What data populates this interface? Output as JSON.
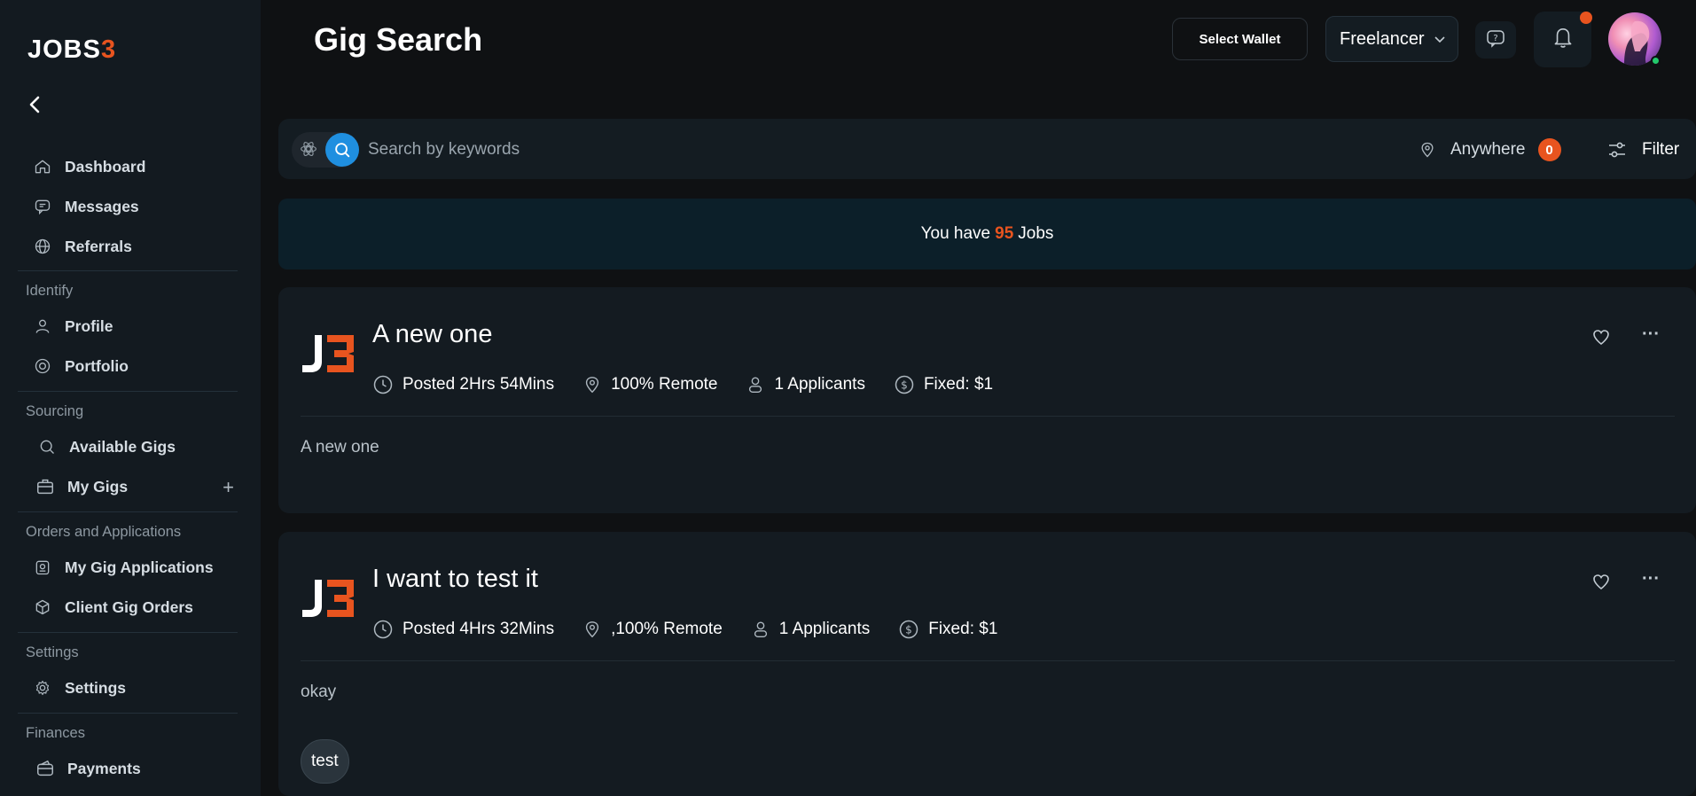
{
  "app": {
    "logo_text": "JOBS",
    "logo_accent": "3",
    "brand_color": "#e8541f"
  },
  "sidebar": {
    "items": [
      {
        "label": "Dashboard",
        "icon": "home-icon"
      },
      {
        "label": "Messages",
        "icon": "message-icon"
      },
      {
        "label": "Referrals",
        "icon": "globe-icon"
      }
    ],
    "sections": [
      {
        "label": "Identify",
        "items": [
          {
            "label": "Profile",
            "icon": "user-icon"
          },
          {
            "label": "Portfolio",
            "icon": "target-icon"
          }
        ]
      },
      {
        "label": "Sourcing",
        "items": [
          {
            "label": "Available Gigs",
            "icon": "search-icon"
          },
          {
            "label": "My Gigs",
            "icon": "briefcase-icon"
          }
        ]
      },
      {
        "label": "Orders and Applications",
        "items": [
          {
            "label": "My Gig Applications",
            "icon": "application-icon"
          },
          {
            "label": "Client Gig Orders",
            "icon": "box-icon"
          }
        ]
      },
      {
        "label": "Settings",
        "items": [
          {
            "label": "Settings",
            "icon": "gear-icon"
          }
        ]
      },
      {
        "label": "Finances",
        "items": [
          {
            "label": "Payments",
            "icon": "wallet-icon"
          }
        ]
      }
    ]
  },
  "header": {
    "title": "Gig Search",
    "wallet_label": "Select Wallet",
    "role": "Freelancer"
  },
  "search": {
    "placeholder": "Search by keywords",
    "location": "Anywhere",
    "location_count": "0",
    "filter_label": "Filter"
  },
  "banner": {
    "prefix": "You have",
    "count": "95",
    "suffix": "Jobs"
  },
  "jobs": [
    {
      "title": "A new one",
      "posted": "Posted 2Hrs 54Mins",
      "location": "100% Remote",
      "applicants": "1 Applicants",
      "price": "Fixed: $1",
      "description": "A new one"
    },
    {
      "title": "I want to test it",
      "posted": "Posted 4Hrs 32Mins",
      "location": ",100% Remote",
      "applicants": "1 Applicants",
      "price": "Fixed: $1",
      "description": "okay",
      "tag": "test"
    }
  ]
}
